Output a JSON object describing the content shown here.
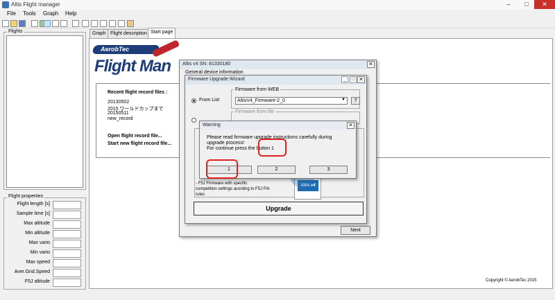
{
  "window": {
    "title": "Altis Flight manager",
    "minimize": "–",
    "maximize": "□",
    "close": "✕"
  },
  "menu": [
    "File",
    "Tools",
    "Graph",
    "Help"
  ],
  "sidebar": {
    "flights_label": "Flights",
    "properties_label": "Flight properties",
    "properties": [
      "Flight length [s]",
      "Sample time [s]",
      "Max altitude",
      "Min altitude",
      "Max vario",
      "Min vario",
      "Max speed",
      "Aver.Gnd.Speed",
      "F5J altitude"
    ]
  },
  "tabs": [
    "Graph",
    "Flight description",
    "Start page"
  ],
  "start_page": {
    "logo_top": "AerobTec",
    "logo_main": "Flight Man",
    "recent_heading": "Recent flight record files :",
    "recent_files": [
      "20130502",
      "2015 ワールドカップまで",
      "20150511",
      "new_record"
    ],
    "open_link": "Open flight record file...",
    "new_link": "Start new flight record file...",
    "copyright": "Copyright © AerobTec 2015"
  },
  "altis_window": {
    "title": "Altis v4   SN: 81330180",
    "info_label": "General device information",
    "close": "✕"
  },
  "wizard": {
    "title": "Firmware Upgrade Wizard",
    "from_list": "From List",
    "firmware_web_label": "Firmware from WEB",
    "firmware_selected": "AltisV4_Firmware-2_0",
    "help_button": "?",
    "firmware_file_label": "Firmware from file",
    "desc_line1": "- F5J Firmware with specific",
    "desc_line2": "competition settings acording to F5J FAI",
    "desc_line3": "rules",
    "product_label": "Altis v4",
    "upgrade_button": "Upgrade",
    "next_button": "Next",
    "win_min": "_",
    "win_max": "□",
    "win_close": "✕"
  },
  "warning": {
    "title": "Warning",
    "line1": "Please read firmware upgrade instructions carefully during",
    "line2": "upgrade process!",
    "line3": "For continue press the button 1",
    "buttons": [
      "1",
      "2",
      "3"
    ],
    "close": "✕"
  }
}
